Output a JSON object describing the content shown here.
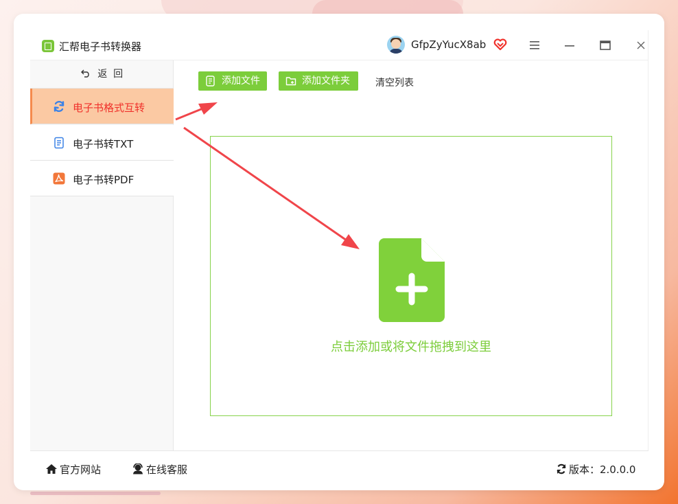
{
  "app": {
    "title": "汇帮电子书转换器",
    "username": "GfpZyYucX8ab",
    "brand_color": "#7ccd3b",
    "accent_color": "#f0312b"
  },
  "titlebar": {
    "menu_icon": "☰",
    "minimize_icon": "—",
    "maximize_icon": "▭",
    "close_icon": "✕"
  },
  "sidebar": {
    "back_label": "返  回",
    "items": [
      {
        "label": "电子书格式互转",
        "icon": "refresh-icon",
        "active": true
      },
      {
        "label": "电子书转TXT",
        "icon": "document-icon",
        "active": false
      },
      {
        "label": "电子书转PDF",
        "icon": "pdf-icon",
        "active": false
      }
    ]
  },
  "toolbar": {
    "add_file_label": "添加文件",
    "add_folder_label": "添加文件夹",
    "clear_list_label": "清空列表"
  },
  "dropzone": {
    "text": "点击添加或将文件拖拽到这里",
    "icon": "file-plus-icon"
  },
  "footer": {
    "official_site_label": "官方网站",
    "customer_service_label": "在线客服",
    "version_label": "版本：2.0.0.0"
  }
}
